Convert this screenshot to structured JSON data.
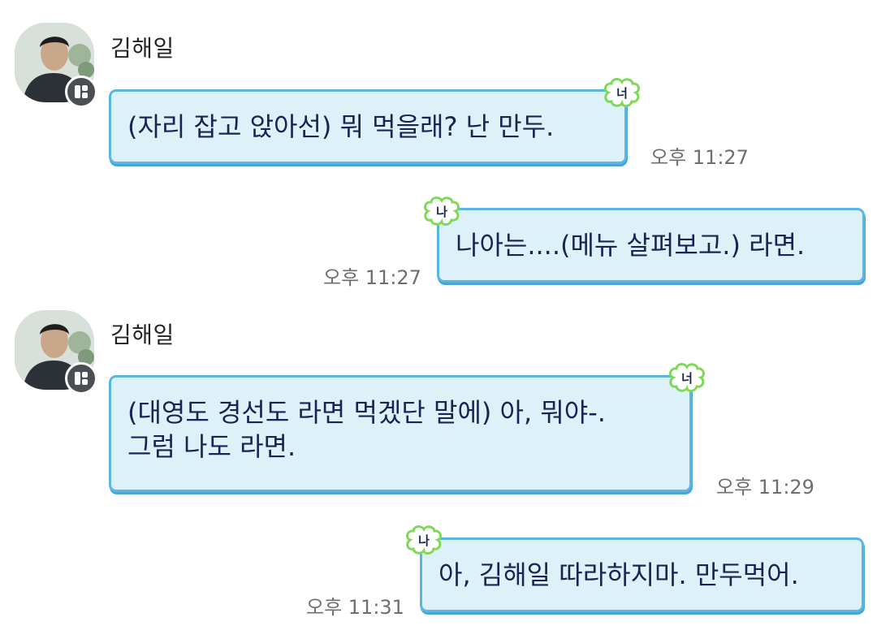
{
  "messages": [
    {
      "side": "them",
      "sender": "김해일",
      "tag": "너",
      "lines": [
        "(자리 잡고 앉아선) 뭐 먹을래? 난 만두."
      ],
      "time": "오후 11:27"
    },
    {
      "side": "me",
      "tag": "나",
      "lines": [
        "나아는....(메뉴 살펴보고.) 라면."
      ],
      "time": "오후 11:27"
    },
    {
      "side": "them",
      "sender": "김해일",
      "tag": "너",
      "lines": [
        "(대영도 경선도 라면 먹겠단 말에) 아, 뭐야-.",
        "그럼 나도 라면."
      ],
      "time": "오후 11:29"
    },
    {
      "side": "me",
      "tag": "나",
      "lines": [
        "아, 김해일 따라하지마. 만두먹어."
      ],
      "time": "오후 11:31"
    }
  ],
  "colors": {
    "bubble_fill": "#dcf1f8",
    "bubble_border": "#5bb6e3",
    "text": "#1a2352",
    "tag_border": "#7ed957",
    "time": "#6e6e6e"
  }
}
